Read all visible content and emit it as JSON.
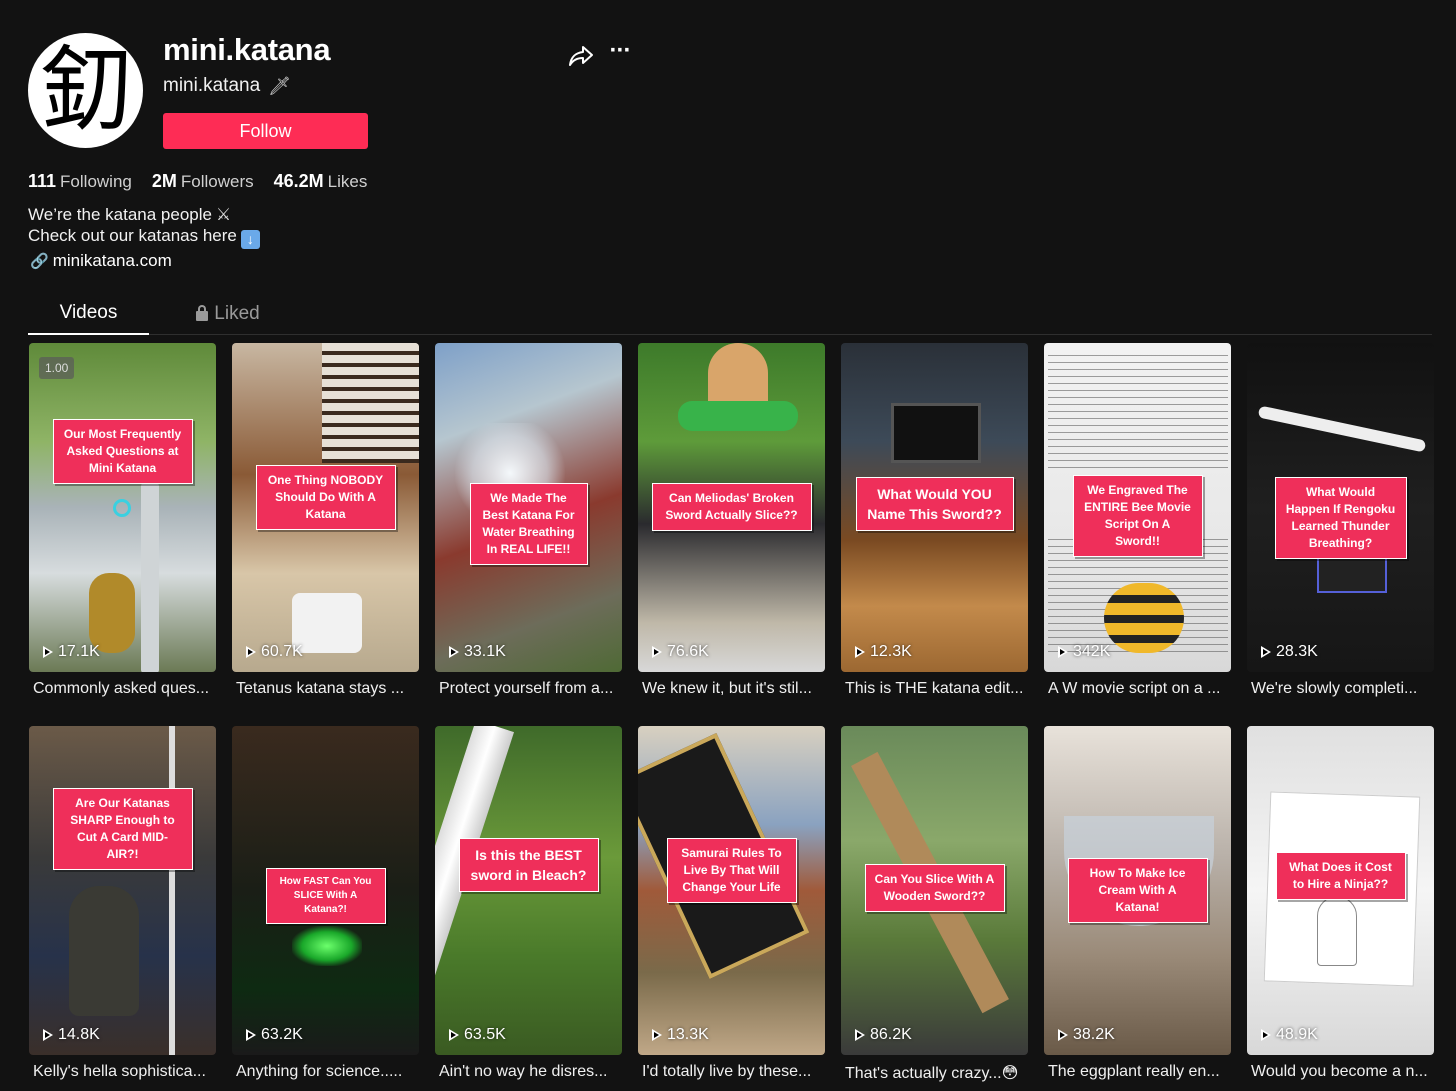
{
  "profile": {
    "avatar_glyph": "釖",
    "username": "mini.katana",
    "nickname": "mini.katana",
    "follow_label": "Follow",
    "stats": {
      "following_count": "111",
      "following_label": "Following",
      "followers_count": "2M",
      "followers_label": "Followers",
      "likes_count": "46.2M",
      "likes_label": "Likes"
    },
    "bio_line1": "We’re the katana people",
    "bio_line2": "Check out our katanas here",
    "link": "minikatana.com"
  },
  "tabs": {
    "videos": "Videos",
    "liked": "Liked"
  },
  "videos": [
    {
      "caption": "Our Most Frequently Asked Questions at Mini Katana",
      "views": "17.1K",
      "title": "Commonly asked ques...",
      "badge": "1.00"
    },
    {
      "caption": "One Thing NOBODY Should Do With A Katana",
      "views": "60.7K",
      "title": "Tetanus katana stays ..."
    },
    {
      "caption": "We Made The Best Katana For Water Breathing In REAL LIFE!!",
      "views": "33.1K",
      "title": "Protect yourself from a..."
    },
    {
      "caption": "Can Meliodas' Broken Sword Actually Slice??",
      "views": "76.6K",
      "title": "We knew it, but it's stil..."
    },
    {
      "caption": "What Would YOU Name This Sword??",
      "views": "12.3K",
      "title": "This is THE katana edit..."
    },
    {
      "caption": "We Engraved The ENTIRE Bee Movie Script On A Sword!!",
      "views": "342K",
      "title": "A W movie script on a ..."
    },
    {
      "caption": "What Would Happen If Rengoku Learned Thunder Breathing?",
      "views": "28.3K",
      "title": "We're slowly completi..."
    },
    {
      "caption": "Are Our Katanas SHARP Enough to Cut A Card MID-AIR?!",
      "views": "14.8K",
      "title": "Kelly's hella sophistica..."
    },
    {
      "caption": "How FAST Can You SLICE With A Katana?!",
      "views": "63.2K",
      "title": "Anything for science....."
    },
    {
      "caption": "Is this the BEST sword in Bleach?",
      "views": "63.5K",
      "title": "Ain't no way he disres..."
    },
    {
      "caption": "Samurai Rules To Live By That Will Change Your Life",
      "views": "13.3K",
      "title": "I'd totally live by these..."
    },
    {
      "caption": "Can You Slice With A Wooden Sword??",
      "views": "86.2K",
      "title": "That's actually crazy...😳"
    },
    {
      "caption": "How To Make Ice Cream With A Katana!",
      "views": "38.2K",
      "title": "The eggplant really en..."
    },
    {
      "caption": "What Does it Cost to Hire a Ninja??",
      "views": "48.9K",
      "title": "Would you become a n..."
    }
  ],
  "colors": {
    "background": "#121212",
    "accent": "#fe2c55",
    "caption_box": "#ef2f5a"
  },
  "icons": [
    "share-icon",
    "more-icon",
    "link-icon",
    "lock-icon",
    "play-icon"
  ]
}
